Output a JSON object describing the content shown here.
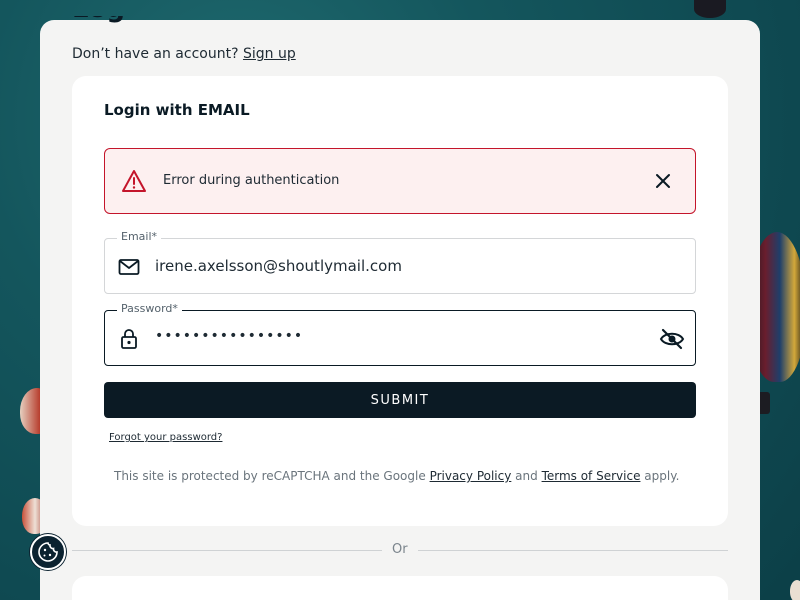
{
  "page": {
    "heading_partial": "Log"
  },
  "signup": {
    "prompt": "Don’t have an account?",
    "link_label": "Sign up"
  },
  "login": {
    "title": "Login with EMAIL"
  },
  "error": {
    "message": "Error during authentication",
    "color": "#c4152b"
  },
  "email_field": {
    "label": "Email*",
    "value": "irene.axelsson@shoutlymail.com"
  },
  "password_field": {
    "label": "Password*",
    "value": "••••••••••••••••"
  },
  "submit": {
    "label": "SUBMIT",
    "color": "#0b1a24"
  },
  "forgot": {
    "label": "Forgot your password?"
  },
  "recaptcha": {
    "prefix": "This site is protected by reCAPTCHA and the Google ",
    "privacy_label": "Privacy Policy",
    "and": " and ",
    "terms_label": "Terms of Service",
    "suffix": " apply."
  },
  "divider": {
    "label": "Or"
  },
  "icons": {
    "error": "warning-icon",
    "close": "close-icon",
    "email": "mail-icon",
    "password": "lock-icon",
    "visibility": "eye-off-icon",
    "cookie": "cookie-icon"
  }
}
